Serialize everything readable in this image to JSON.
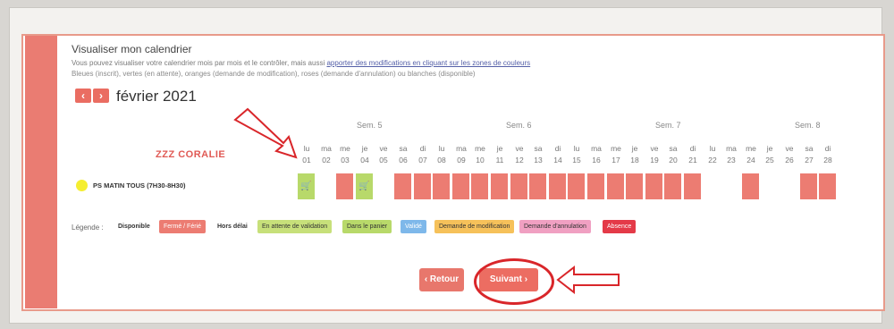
{
  "panel": {
    "title": "Visualiser mon calendrier",
    "desc_prefix": "Vous pouvez visualiser votre calendrier mois par mois et le contrôler, mais aussi ",
    "desc_link": "apporter des modifications en cliquant sur les zones de couleurs",
    "desc_line2": "Bleues (inscrit), vertes (en attente), oranges (demande de modification), roses (demande d'annulation) ou blanches (disponible)"
  },
  "nav": {
    "prev": "‹",
    "next": "›",
    "month": "février 2021"
  },
  "weeks": [
    "Sem. 5",
    "Sem. 6",
    "Sem. 7",
    "Sem. 8"
  ],
  "user_name": "ZZZ CORALIE",
  "days": [
    {
      "d": "lu",
      "n": "01"
    },
    {
      "d": "ma",
      "n": "02"
    },
    {
      "d": "me",
      "n": "03"
    },
    {
      "d": "je",
      "n": "04"
    },
    {
      "d": "ve",
      "n": "05"
    },
    {
      "d": "sa",
      "n": "06"
    },
    {
      "d": "di",
      "n": "07"
    },
    {
      "d": "lu",
      "n": "08"
    },
    {
      "d": "ma",
      "n": "09"
    },
    {
      "d": "me",
      "n": "10"
    },
    {
      "d": "je",
      "n": "11"
    },
    {
      "d": "ve",
      "n": "12"
    },
    {
      "d": "sa",
      "n": "13"
    },
    {
      "d": "di",
      "n": "14"
    },
    {
      "d": "lu",
      "n": "15"
    },
    {
      "d": "ma",
      "n": "16"
    },
    {
      "d": "me",
      "n": "17"
    },
    {
      "d": "je",
      "n": "18"
    },
    {
      "d": "ve",
      "n": "19"
    },
    {
      "d": "sa",
      "n": "20"
    },
    {
      "d": "di",
      "n": "21"
    },
    {
      "d": "lu",
      "n": "22"
    },
    {
      "d": "ma",
      "n": "23"
    },
    {
      "d": "me",
      "n": "24"
    },
    {
      "d": "je",
      "n": "25"
    },
    {
      "d": "ve",
      "n": "26"
    },
    {
      "d": "sa",
      "n": "27"
    },
    {
      "d": "di",
      "n": "28"
    }
  ],
  "row": {
    "label": "PS MATIN TOUS (7H30-8H30)",
    "cells": [
      "panier",
      "",
      "ferme",
      "panier",
      "",
      "ferme",
      "ferme",
      "ferme",
      "ferme",
      "ferme",
      "ferme",
      "ferme",
      "ferme",
      "ferme",
      "ferme",
      "ferme",
      "ferme",
      "ferme",
      "ferme",
      "ferme",
      "ferme",
      "",
      "",
      "ferme",
      "",
      "",
      "ferme",
      "ferme"
    ]
  },
  "legend": {
    "title": "Légende :",
    "items": [
      {
        "label": "Disponible",
        "bg": "",
        "fg": "#333"
      },
      {
        "label": "Fermé / Férié",
        "bg": "#ec7c72",
        "fg": "#ffffff"
      },
      {
        "label": "Hors délai",
        "bg": "",
        "fg": "#333"
      },
      {
        "label": "En attente de validation",
        "bg": "#c7e07a",
        "fg": "#333"
      },
      {
        "label": "Dans le panier",
        "bg": "#b8d96a",
        "fg": "#333"
      },
      {
        "label": "Validé",
        "bg": "#7eb8ea",
        "fg": "#ffffff"
      },
      {
        "label": "Demande de modification",
        "bg": "#f6c15a",
        "fg": "#333"
      },
      {
        "label": "Demande d'annulation",
        "bg": "#f0a0c2",
        "fg": "#333"
      },
      {
        "label": "Absence",
        "bg": "#e43a48",
        "fg": "#ffffff"
      }
    ]
  },
  "buttons": {
    "back": "‹ Retour",
    "next": "Suivant ›"
  },
  "colors": {
    "accent": "#ec6d62",
    "annotation": "#d9262a"
  },
  "icons": {
    "cell": "basket-icon"
  }
}
